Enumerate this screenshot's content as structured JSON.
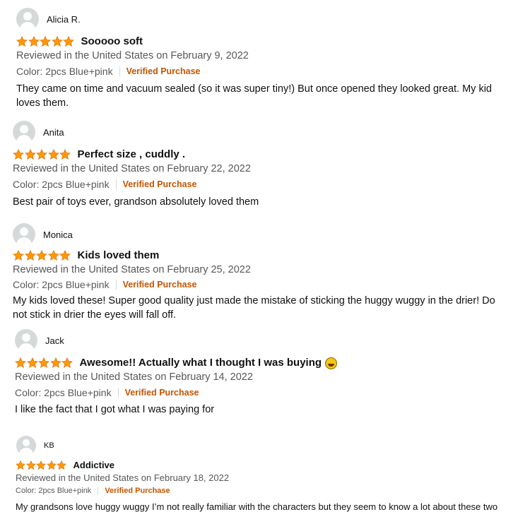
{
  "reviews": [
    {
      "name": "Alicia R.",
      "rating": 5,
      "title": "Sooooo soft",
      "date": "Reviewed in the United States on February 9, 2022",
      "color": "Color: 2pcs Blue+pink",
      "verified": "Verified Purchase",
      "body": "They came on time and vacuum sealed (so it was super tiny!) But once opened they looked great. My kid loves them."
    },
    {
      "name": "Anita",
      "rating": 5,
      "title": "Perfect size , cuddly .",
      "date": "Reviewed in the United States on February 22, 2022",
      "color": "Color: 2pcs Blue+pink",
      "verified": "Verified Purchase",
      "body": "Best pair of toys ever, grandson absolutely loved them"
    },
    {
      "name": "Monica",
      "rating": 5,
      "title": "Kids loved them",
      "date": "Reviewed in the United States on February 25, 2022",
      "color": "Color: 2pcs Blue+pink",
      "verified": "Verified Purchase",
      "body": "My kids loved these! Super good quality just made the mistake of sticking the huggy wuggy in the drier! Do not stick in drier the eyes will fall off."
    },
    {
      "name": "Jack",
      "rating": 5,
      "title": "Awesome!! Actually what I thought I was buying",
      "date": "Reviewed in the United States on February 14, 2022",
      "color": "Color: 2pcs Blue+pink",
      "verified": "Verified Purchase",
      "body": "I like the fact that I got what I was paying for"
    },
    {
      "name": "KB",
      "rating": 5,
      "title": "Addictive",
      "date": "Reviewed in the United States on February 18, 2022",
      "color": "Color: 2pcs Blue+pink",
      "verified": "Verified Purchase",
      "body": "My grandsons love huggy wuggy I’m not really familiar with the characters but they seem to know a lot about these two"
    }
  ],
  "colors": {
    "star": "#ff9900",
    "verified": "#c45500",
    "meta": "#565959"
  }
}
